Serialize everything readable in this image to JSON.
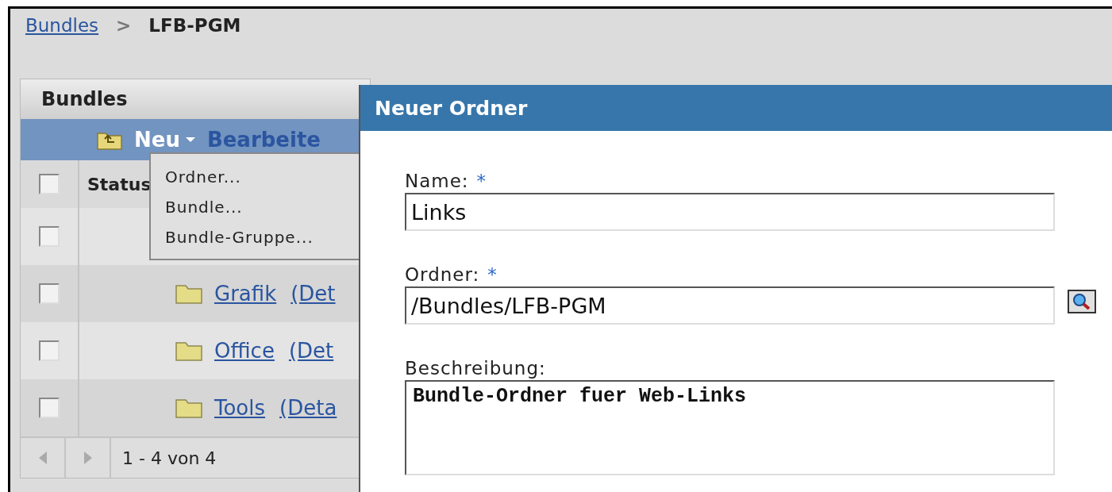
{
  "breadcrumb": {
    "link": "Bundles",
    "separator": ">",
    "current": "LFB-PGM"
  },
  "panel": {
    "title": "Bundles",
    "toolbar": {
      "new_menu": "Neu",
      "edit": "Bearbeite"
    },
    "menu": [
      {
        "label": "Ordner..."
      },
      {
        "label": "Bundle..."
      },
      {
        "label": "Bundle-Gruppe..."
      }
    ],
    "table": {
      "header": {
        "checked": false,
        "column_2": "Status"
      },
      "rows": [
        {
          "checked": false
        },
        {
          "checked": false,
          "name": "Grafik",
          "details": "(Det"
        },
        {
          "checked": false,
          "name": "Office",
          "details": "(Det"
        },
        {
          "checked": false,
          "name": "Tools",
          "details": "(Deta"
        }
      ]
    },
    "pager": "1 - 4 von 4"
  },
  "dialog": {
    "title": "Neuer Ordner",
    "fields": [
      {
        "kind": "input",
        "label": "Name:",
        "required_mark": "*",
        "value": "Links",
        "browse": false
      },
      {
        "kind": "input",
        "label": "Ordner:",
        "required_mark": "*",
        "value": "/Bundles/LFB-PGM",
        "browse": true
      },
      {
        "kind": "textarea",
        "label": "Beschreibung:",
        "value": "Bundle-Ordner fuer Web-Links",
        "browse": false
      }
    ]
  }
}
